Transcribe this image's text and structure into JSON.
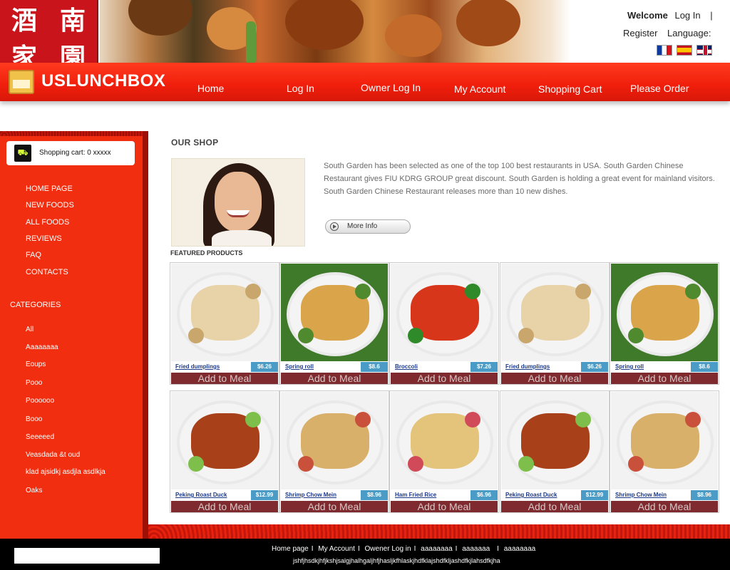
{
  "header": {
    "logo_chars": [
      "酒",
      "南",
      "家",
      "園"
    ],
    "welcome": "Welcome",
    "login_link": "Log In",
    "separator": "|",
    "register": "Register",
    "language": "Language:",
    "flags": [
      "flag-france-icon",
      "flag-spain-icon",
      "flag-uk-icon"
    ]
  },
  "nav": {
    "brand": "USLUNCHBOX",
    "items": [
      {
        "label": "Home"
      },
      {
        "label": "Log In"
      },
      {
        "label": "Owner Log In"
      },
      {
        "label": "My Account"
      },
      {
        "label": "Shopping Cart"
      },
      {
        "label": "Please Order"
      }
    ]
  },
  "sidebar": {
    "cart_label": "Shopping cart:  0 xxxxx",
    "links": [
      "HOME PAGE",
      "NEW FOODS",
      "ALL FOODS",
      "REVIEWS",
      "FAQ",
      "CONTACTS"
    ],
    "categories_heading": "CATEGORIES",
    "categories": [
      "All",
      "Aaaaaaaa",
      "Eoups",
      "Pooo",
      "Poooooo",
      "Booo",
      "Seeeeed",
      "Veasdada &t oud",
      "klad ajsidkj asdjla asdlkja",
      "Oaks"
    ]
  },
  "main": {
    "title": "OUR SHOP",
    "intro": "South Garden has been selected as one of the top 100 best restaurants in USA. South Garden Chinese Restaurant gives FIU KDRG GROUP great discount. South Garden is holding a great event for mainland visitors. South Garden Chinese Restaurant releases more than 10 new dishes.",
    "more_info": "More Info",
    "featured_title": "FEATURED PRODUCTS",
    "add_label": "Add to Meal",
    "products": [
      {
        "name": "Fried dumplings",
        "price": "$6.26"
      },
      {
        "name": "Spring roll",
        "price": "$8.6"
      },
      {
        "name": "Broccoli",
        "price": "$7.26"
      },
      {
        "name": "Fried dumplings",
        "price": "$6.26"
      },
      {
        "name": "Spring roll",
        "price": "$8.6"
      },
      {
        "name": "Peking Roast Duck",
        "price": "$12.99"
      },
      {
        "name": "Shrimp Chow Mein",
        "price": "$8.96"
      },
      {
        "name": "Ham Fried Rice",
        "price": "$6.96"
      },
      {
        "name": "Peking Roast Duck",
        "price": "$12.99"
      },
      {
        "name": "Shrimp Chow Mein",
        "price": "$8.96"
      }
    ]
  },
  "footer": {
    "links": [
      "Home page",
      "My Account",
      "Owener Log in",
      "aaaaaaaa",
      "aaaaaaa",
      "aaaaaaaa"
    ],
    "note": "jshfjhsdkjhfjkshjsalgjhalhgaljhfjhasljkfhlaskjhdfklajshdfkljashdfkjlahsdfkjha"
  },
  "colors": {
    "nav_red": "#f01e0c",
    "sidebar_red": "#f12f10",
    "add_button": "#7e2a2e",
    "price_badge": "#4a9bc6",
    "footer": "#000000"
  }
}
